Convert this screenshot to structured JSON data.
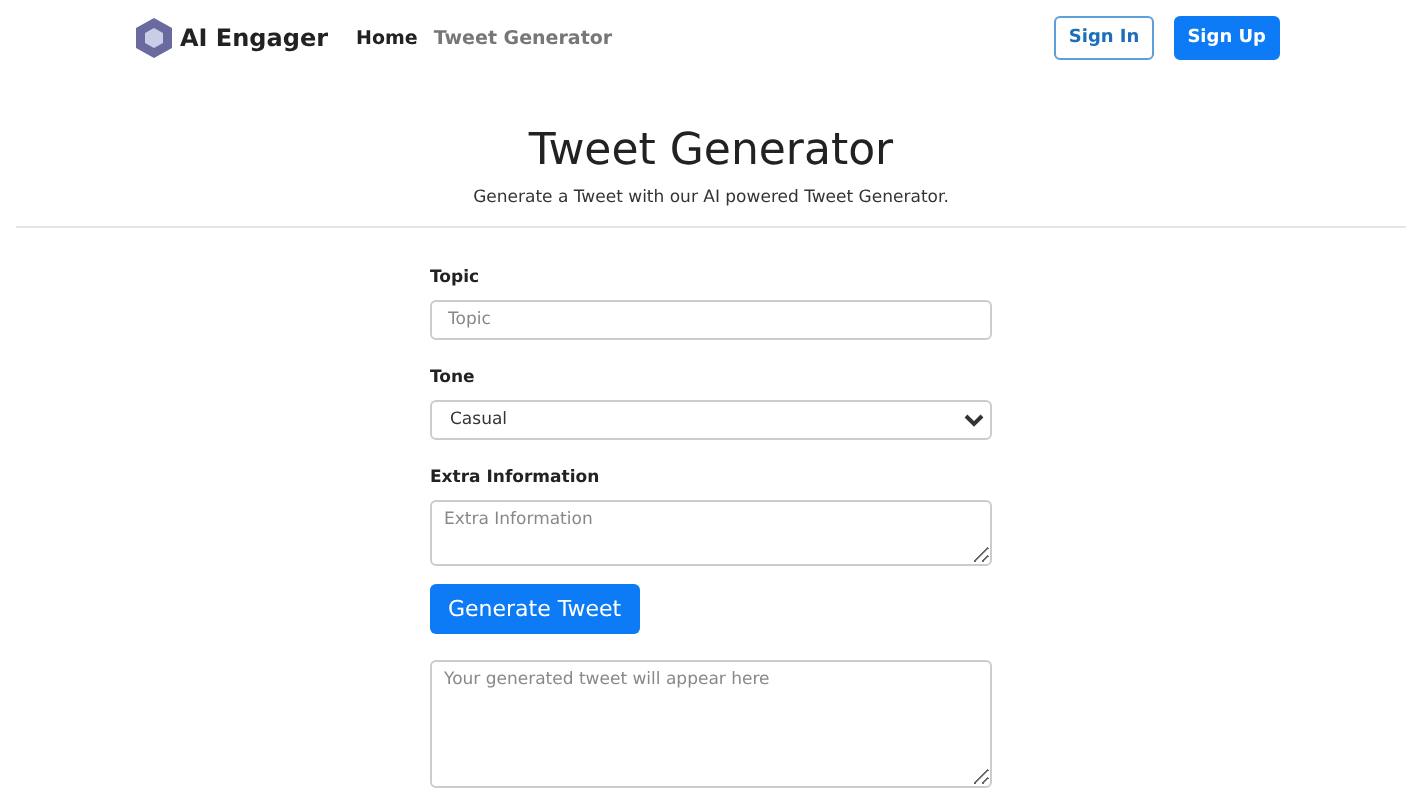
{
  "brand": {
    "name": "AI Engager"
  },
  "nav": [
    {
      "label": "Home",
      "selected": true
    },
    {
      "label": "Tweet Generator",
      "selected": false
    }
  ],
  "auth_buttons": [
    {
      "label": "Sign In",
      "kind": "outline"
    },
    {
      "label": "Sign Up",
      "kind": "solid"
    }
  ],
  "header": {
    "title": "Tweet Generator",
    "subtitle": "Generate a Tweet with our AI powered Tweet Generator."
  },
  "form": {
    "fields": [
      {
        "kind": "input",
        "label": "Topic",
        "placeholder": "Topic"
      },
      {
        "kind": "select",
        "label": "Tone",
        "value": "Casual"
      },
      {
        "kind": "textarea",
        "label": "Extra Information",
        "placeholder": "Extra Information"
      }
    ],
    "submit": "Generate Tweet",
    "output": {
      "placeholder": "Your generated tweet will appear here"
    }
  }
}
